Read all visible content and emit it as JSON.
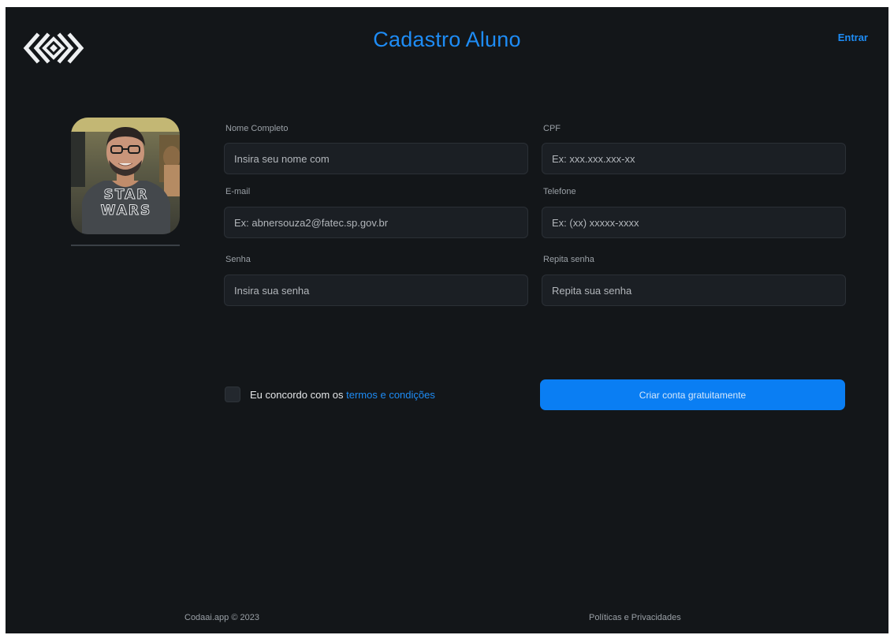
{
  "header": {
    "title": "Cadastro Aluno",
    "login_label": "Entrar"
  },
  "form": {
    "full_name": {
      "label": "Nome Completo",
      "placeholder": "Insira seu nome com",
      "value": ""
    },
    "cpf": {
      "label": "CPF",
      "placeholder": "Ex: xxx.xxx.xxx-xx",
      "value": ""
    },
    "email": {
      "label": "E-mail",
      "placeholder": "Ex: abnersouza2@fatec.sp.gov.br",
      "value": ""
    },
    "phone": {
      "label": "Telefone",
      "placeholder": "Ex: (xx) xxxxx-xxxx",
      "value": ""
    },
    "password": {
      "label": "Senha",
      "placeholder": "Insira sua senha",
      "value": ""
    },
    "password_confirm": {
      "label": "Repita senha",
      "placeholder": "Repita sua senha",
      "value": ""
    },
    "agree_prefix": "Eu concordo com os",
    "agree_link": "termos e condições",
    "agree_checked": false,
    "submit_label": "Criar conta gratuitamente"
  },
  "avatar": {
    "shirt_text_line1": "STAR",
    "shirt_text_line2": "WARS"
  },
  "footer": {
    "copyright": "Codaai.app © 2023",
    "policies": "Políticas e Privacidades"
  },
  "colors": {
    "background": "#131619",
    "accent": "#1e8cf5",
    "button": "#0a7ef3",
    "input_background": "#1b1f24"
  }
}
